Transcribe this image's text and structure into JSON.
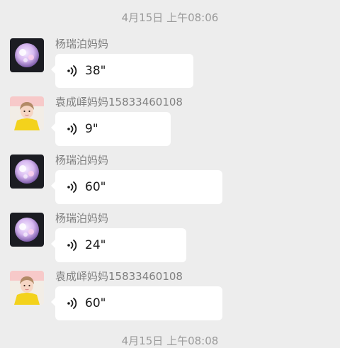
{
  "timestamps": {
    "top": "4月15日 上午08:06",
    "bottom": "4月15日 上午08:08"
  },
  "messages": [
    {
      "sender": "杨瑞泊妈妈",
      "duration": "38\"",
      "avatar": "purple-orb-avatar"
    },
    {
      "sender": "袁成峄妈妈15833460108",
      "duration": "9\"",
      "avatar": "girl-yellow-shirt-avatar"
    },
    {
      "sender": "杨瑞泊妈妈",
      "duration": "60\"",
      "avatar": "purple-orb-avatar"
    },
    {
      "sender": "杨瑞泊妈妈",
      "duration": "24\"",
      "avatar": "purple-orb-avatar"
    },
    {
      "sender": "袁成峄妈妈15833460108",
      "duration": "60\"",
      "avatar": "girl-yellow-shirt-avatar"
    }
  ],
  "colors": {
    "background": "#ededed",
    "bubble": "#ffffff",
    "sender_text": "#7f7f7f",
    "timestamp_text": "#9a9a9a"
  }
}
